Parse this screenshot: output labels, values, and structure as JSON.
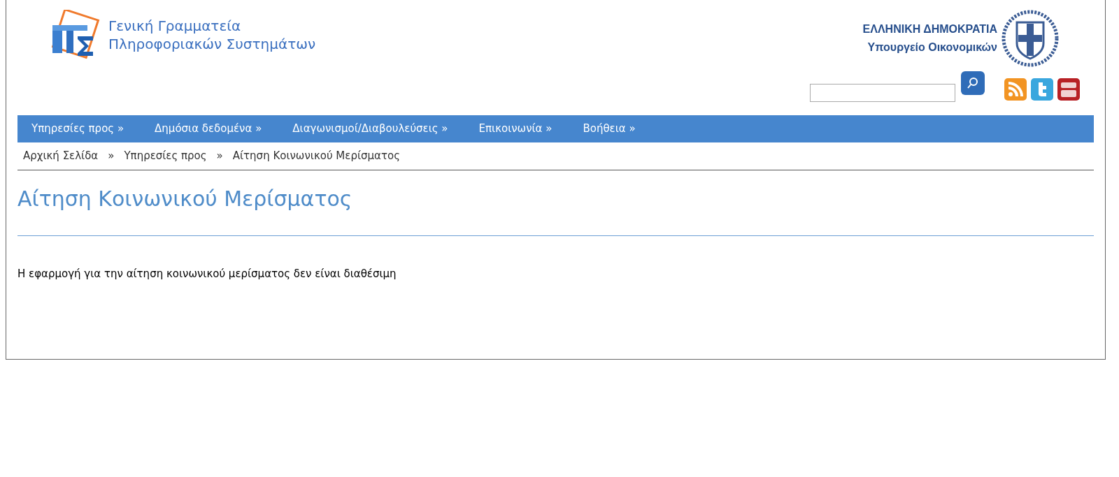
{
  "header": {
    "org_lines": [
      "Γενική Γραμματεία",
      "Πληροφοριακών Συστημάτων"
    ],
    "state_lines": [
      "ΕΛΛΗΝΙΚΗ ΔΗΜΟΚΡΑΤΙΑ",
      "Υπουργείο Οικονομικών"
    ]
  },
  "nav": [
    "Υπηρεσίες προς »",
    "Δημόσια δεδομένα »",
    "Διαγωνισμοί/Διαβουλεύσεις »",
    "Επικοινωνία »",
    "Βοήθεια »"
  ],
  "breadcrumb": {
    "items": [
      "Αρχική Σελίδα",
      "Υπηρεσίες προς",
      "Αίτηση Κοινωνικού Μερίσματος"
    ],
    "separator": "»"
  },
  "page_title": "Αίτηση Κοινωνικού Μερίσματος",
  "message": "Η εφαρμογή για την αίτηση κοινωνικού μερίσματος δεν είναι διαθέσιμη"
}
